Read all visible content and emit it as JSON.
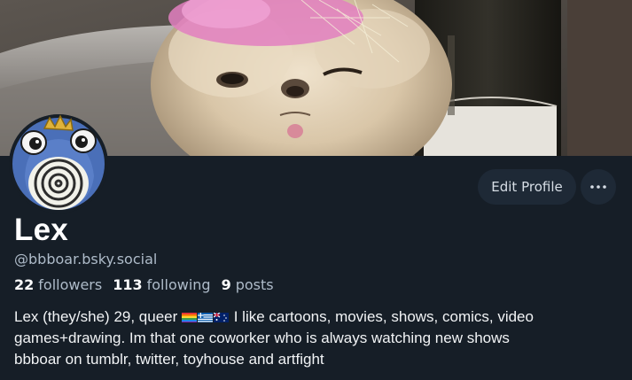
{
  "profile": {
    "display_name": "Lex",
    "handle": "@bbboar.bsky.social",
    "stats": {
      "followers_count": "22",
      "followers_label": "followers",
      "following_count": "113",
      "following_label": "following",
      "posts_count": "9",
      "posts_label": "posts"
    },
    "bio": {
      "line1_before_flags": "Lex (they/she) 29, queer ",
      "line1_after_flags": " I like cartoons, movies, shows, comics, video",
      "line2": "games+drawing. Im that one coworker who is always watching new shows",
      "line3": "bbboar on tumblr, twitter, toyhouse and artfight"
    }
  },
  "actions": {
    "edit_profile_label": "Edit Profile",
    "more_label": "⋯"
  },
  "icons": {
    "banner": "cat-photo-banner",
    "avatar": "poliwag-avatar-icon",
    "flags": [
      "rainbow-flag-icon",
      "greek-flag-icon",
      "australian-flag-icon"
    ]
  },
  "colors": {
    "background": "#161e27",
    "button_bg": "#1e2936",
    "secondary_text": "#aebbc9"
  }
}
